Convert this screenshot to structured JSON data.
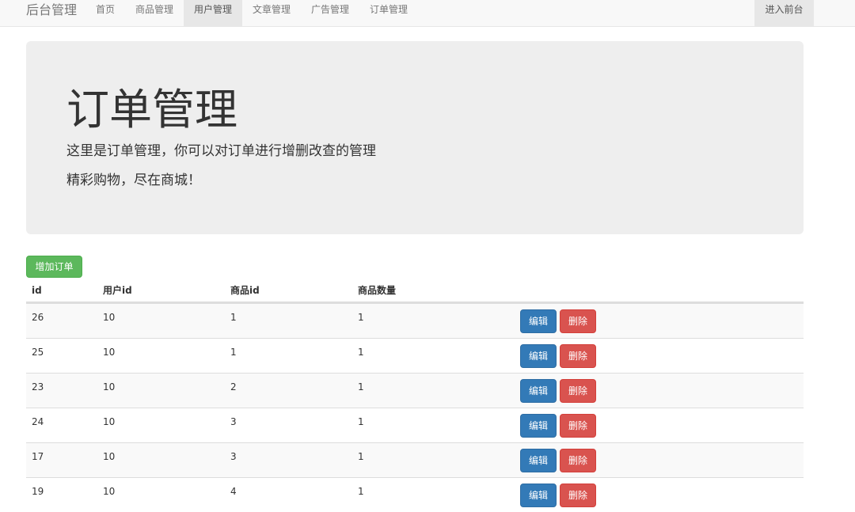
{
  "navbar": {
    "brand": "后台管理",
    "items": [
      {
        "label": "首页",
        "active": false
      },
      {
        "label": "商品管理",
        "active": false
      },
      {
        "label": "用户管理",
        "active": true
      },
      {
        "label": "文章管理",
        "active": false
      },
      {
        "label": "广告管理",
        "active": false
      },
      {
        "label": "订单管理",
        "active": false
      }
    ],
    "right_label": "进入前台"
  },
  "jumbotron": {
    "title": "订单管理",
    "line1": "这里是订单管理，你可以对订单进行增删改查的管理",
    "line2": "精彩购物，尽在商城！"
  },
  "add_button_label": "增加订单",
  "table": {
    "headers": [
      "id",
      "用户id",
      "商品id",
      "商品数量"
    ],
    "edit_label": "编辑",
    "delete_label": "删除",
    "rows": [
      [
        "26",
        "10",
        "1",
        "1"
      ],
      [
        "25",
        "10",
        "1",
        "1"
      ],
      [
        "23",
        "10",
        "2",
        "1"
      ],
      [
        "24",
        "10",
        "3",
        "1"
      ],
      [
        "17",
        "10",
        "3",
        "1"
      ],
      [
        "19",
        "10",
        "4",
        "1"
      ]
    ]
  },
  "colors": {
    "success": "#5cb85c",
    "primary": "#337ab7",
    "danger": "#d9534f",
    "jumbotron_bg": "#eeeeee",
    "navbar_bg": "#f8f8f8"
  }
}
